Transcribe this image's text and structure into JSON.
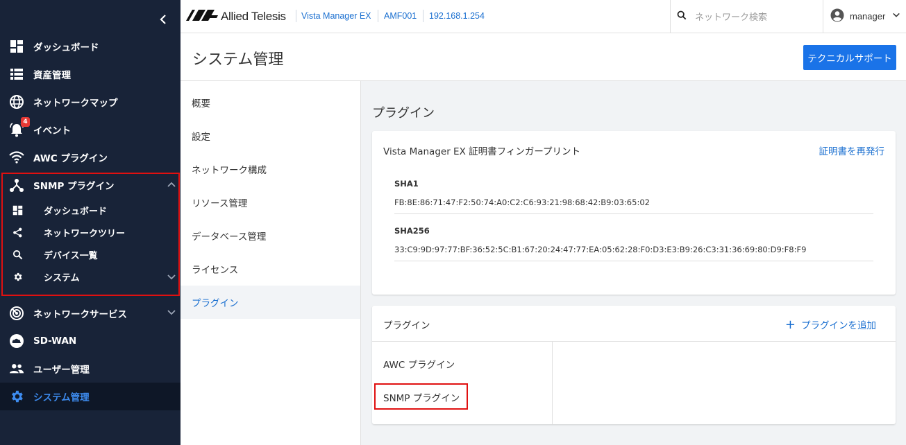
{
  "header": {
    "logo_text": "Allied Telesis",
    "app_name": "Vista Manager EX",
    "device_name": "AMF001",
    "ip_address": "192.168.1.254",
    "search_placeholder": "ネットワーク検索",
    "username": "manager"
  },
  "sidebar": {
    "items": [
      {
        "label": "ダッシュボード",
        "icon": "dashboard-icon"
      },
      {
        "label": "資産管理",
        "icon": "list-icon"
      },
      {
        "label": "ネットワークマップ",
        "icon": "globe-icon"
      },
      {
        "label": "イベント",
        "icon": "bell-icon",
        "badge": "4"
      },
      {
        "label": "AWC プラグイン",
        "icon": "wifi-icon"
      },
      {
        "label": "SNMP プラグイン",
        "icon": "network-icon"
      },
      {
        "label": "ネットワークサービス",
        "icon": "radar-icon"
      },
      {
        "label": "SD-WAN",
        "icon": "cloud-icon"
      },
      {
        "label": "ユーザー管理",
        "icon": "people-icon"
      },
      {
        "label": "システム管理",
        "icon": "gear-icon"
      }
    ],
    "snmp_sub": [
      {
        "label": "ダッシュボード",
        "icon": "dashboard-icon"
      },
      {
        "label": "ネットワークツリー",
        "icon": "share-icon"
      },
      {
        "label": "デバイス一覧",
        "icon": "search-icon"
      },
      {
        "label": "システム",
        "icon": "gear-icon"
      }
    ]
  },
  "page": {
    "title": "システム管理",
    "support_button": "テクニカルサポート"
  },
  "subnav": {
    "items": [
      "概要",
      "設定",
      "ネットワーク構成",
      "リソース管理",
      "データベース管理",
      "ライセンス",
      "プラグイン"
    ],
    "active": "プラグイン"
  },
  "content": {
    "section_title": "プラグイン",
    "fingerprint_card": {
      "title": "Vista Manager EX 証明書フィンガープリント",
      "reissue_link": "証明書を再発行",
      "sha1_label": "SHA1",
      "sha1_value": "FB:8E:86:71:47:F2:50:74:A0:C2:C6:93:21:98:68:42:B9:03:65:02",
      "sha256_label": "SHA256",
      "sha256_value": "33:C9:9D:97:77:BF:36:52:5C:B1:67:20:24:47:77:EA:05:62:28:F0:D3:E3:B9:26:C3:31:36:69:80:D9:F8:F9"
    },
    "plugin_card": {
      "title": "プラグイン",
      "add_link": "プラグインを追加",
      "plugins": [
        "AWC プラグイン",
        "SNMP プラグイン"
      ]
    }
  },
  "colors": {
    "sidebar_bg": "#182338",
    "accent": "#1a73e8",
    "highlight": "#e01010"
  }
}
